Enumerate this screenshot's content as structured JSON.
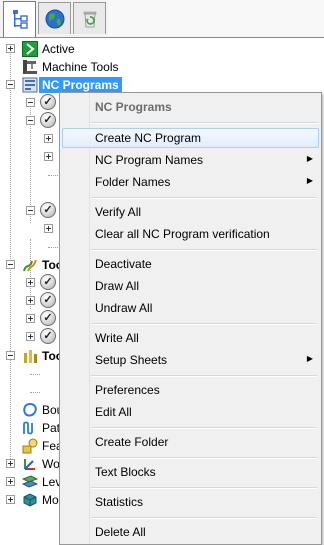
{
  "tabs": [
    {
      "name": "explorer-tab",
      "icon": "tree-hierarchy-icon",
      "active": true
    },
    {
      "name": "globe-tab",
      "icon": "globe-icon",
      "active": false
    },
    {
      "name": "recycle-tab",
      "icon": "recycle-bin-icon",
      "active": false
    }
  ],
  "tree": {
    "active": "Active",
    "machine_tools": "Machine Tools",
    "nc_programs": "NC Programs",
    "toolpaths_1": "Too",
    "toolpaths_2": "Too",
    "boundaries": "Bou",
    "patterns": "Pat",
    "feature_sets": "Fea",
    "workplanes": "Wo",
    "levels": "Lev",
    "models": "Mo"
  },
  "menu": {
    "header": "NC Programs",
    "items": [
      {
        "label": "Create NC Program",
        "submenu": false
      },
      {
        "label": "NC Program Names",
        "submenu": true
      },
      {
        "label": "Folder Names",
        "submenu": true
      },
      {
        "label": "Verify All",
        "submenu": false
      },
      {
        "label": "Clear all NC Program verification",
        "submenu": false
      },
      {
        "label": "Deactivate",
        "submenu": false
      },
      {
        "label": "Draw All",
        "submenu": false
      },
      {
        "label": "Undraw All",
        "submenu": false
      },
      {
        "label": "Write All",
        "submenu": false
      },
      {
        "label": "Setup Sheets",
        "submenu": true
      },
      {
        "label": "Preferences",
        "submenu": false
      },
      {
        "label": "Edit All",
        "submenu": false
      },
      {
        "label": "Create Folder",
        "submenu": false
      },
      {
        "label": "Text Blocks",
        "submenu": false
      },
      {
        "label": "Statistics",
        "submenu": false
      },
      {
        "label": "Delete All",
        "submenu": false
      }
    ],
    "submenu_arrow": "▶"
  },
  "colors": {
    "selection": "#3399ff",
    "menu_bg": "#f0f0f0",
    "hover_border": "#a8d1f5"
  }
}
